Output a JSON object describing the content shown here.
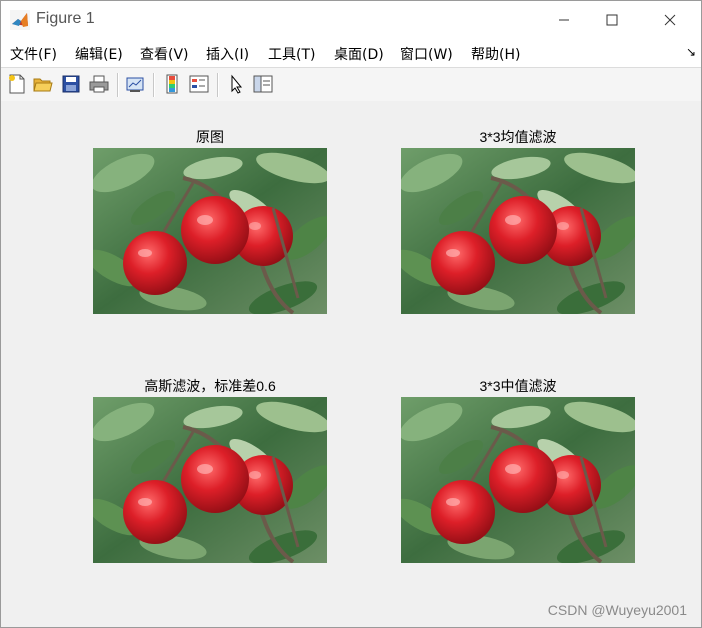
{
  "window": {
    "title": "Figure 1",
    "icon": "matlab-icon"
  },
  "menu": [
    {
      "label": "文件(F)"
    },
    {
      "label": "编辑(E)"
    },
    {
      "label": "查看(V)"
    },
    {
      "label": "插入(I)"
    },
    {
      "label": "工具(T)"
    },
    {
      "label": "桌面(D)"
    },
    {
      "label": "窗口(W)"
    },
    {
      "label": "帮助(H)"
    }
  ],
  "menu_corner_glyph": "↘",
  "toolbar": {
    "buttons": [
      "new-figure-icon",
      "open-file-icon",
      "save-icon",
      "print-icon",
      "link-plot-icon",
      "colorbar-icon",
      "legend-icon",
      "pointer-icon",
      "property-editor-icon"
    ]
  },
  "subplots": [
    {
      "title": "原图",
      "image": "apple-photo"
    },
    {
      "title": "3*3均值滤波",
      "image": "apple-photo"
    },
    {
      "title": "高斯滤波，标准差0.6",
      "image": "apple-photo"
    },
    {
      "title": "3*3中值滤波",
      "image": "apple-photo"
    }
  ],
  "watermark": "CSDN @Wuyeyu2001",
  "colors": {
    "background": "#f0f0f0",
    "apple_red": "#d8202a",
    "leaf_green": "#3f7a3a"
  }
}
